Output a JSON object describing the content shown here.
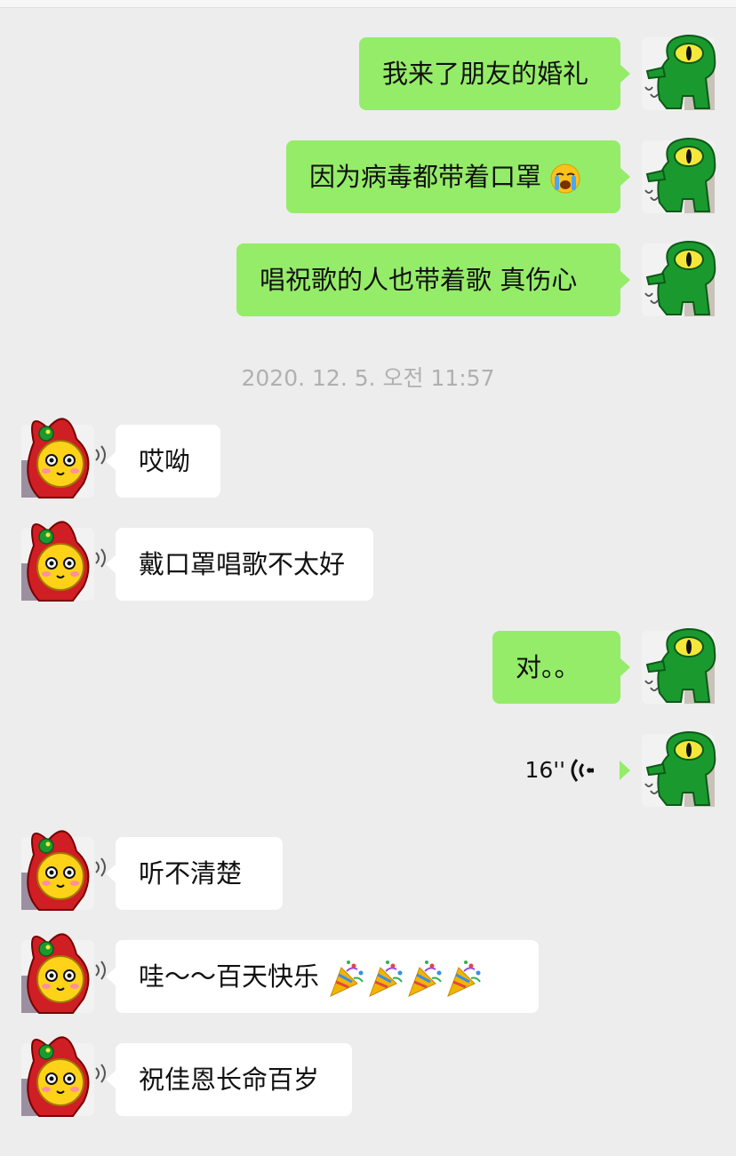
{
  "timestamp": "2020. 12. 5. 오전 11:57",
  "messages": [
    {
      "side": "out",
      "text": "我来了朋友的婚礼"
    },
    {
      "side": "out",
      "text": "因为病毒都带着口罩",
      "emoji": "crying-face-icon"
    },
    {
      "side": "out",
      "text": "唱祝歌的人也带着歌 真伤心"
    },
    {
      "side": "in",
      "text": "哎呦"
    },
    {
      "side": "in",
      "text": "戴口罩唱歌不太好"
    },
    {
      "side": "out",
      "text": "对。。"
    },
    {
      "side": "out",
      "voice_duration": "16''",
      "icon": "voice-wave-icon"
    },
    {
      "side": "in",
      "text": "听不清楚"
    },
    {
      "side": "in",
      "text": "哇～～百天快乐",
      "emoji": "party-popper-icon",
      "emoji_count": 4
    },
    {
      "side": "in",
      "text": "祝佳恩长命百岁"
    }
  ],
  "avatars": {
    "self": "green-monster-avatar",
    "friend": "yellow-rabbit-hood-avatar"
  },
  "colors": {
    "background": "#ededed",
    "outgoing_bubble": "#95ec69",
    "incoming_bubble": "#ffffff",
    "timestamp_text": "#b0b0b0"
  }
}
